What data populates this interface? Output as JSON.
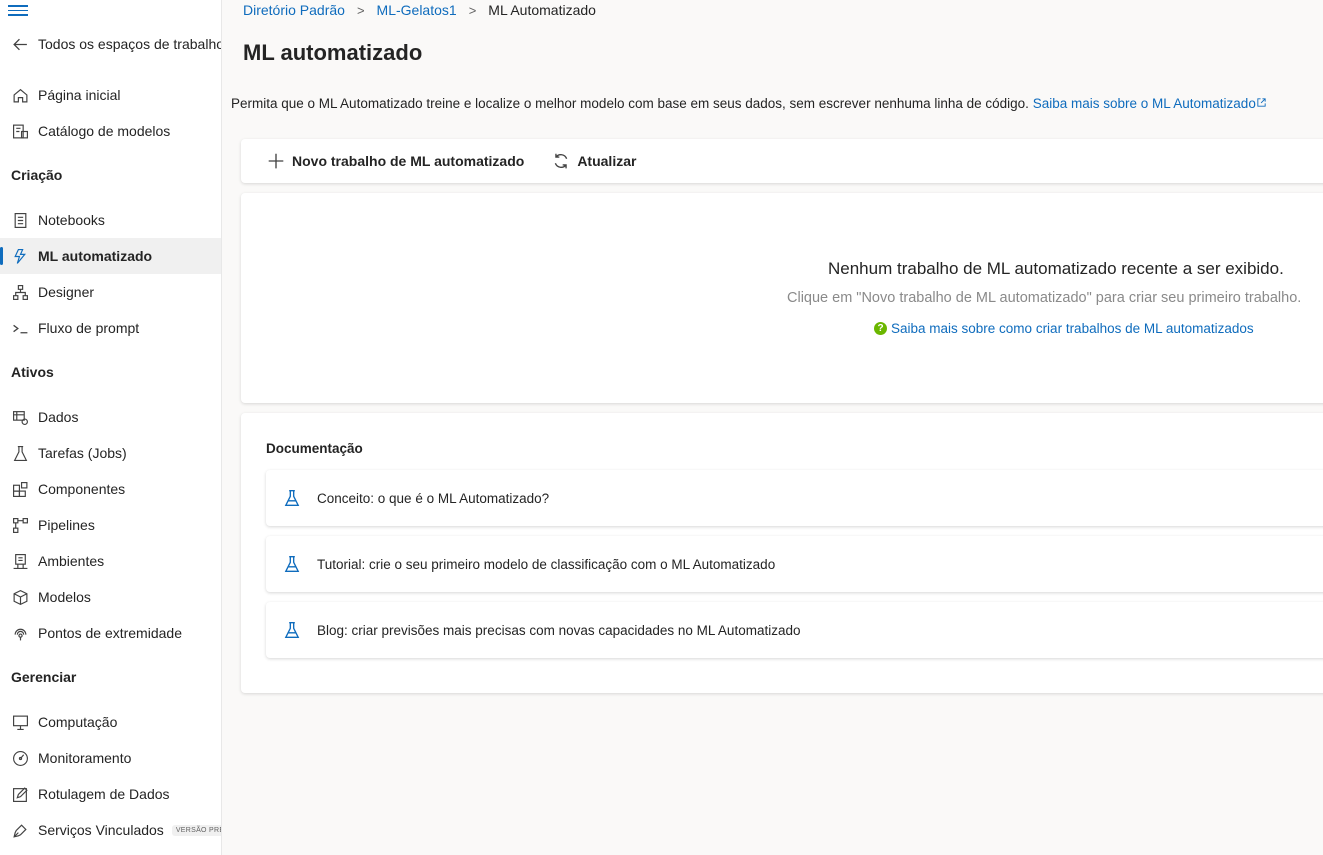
{
  "sidebar": {
    "back_label": "Todos os espaços de trabalho",
    "items_top": [
      {
        "label": "Página inicial",
        "icon": "home-icon"
      },
      {
        "label": "Catálogo de modelos",
        "icon": "model-catalog-icon"
      }
    ],
    "sections": [
      {
        "title": "Criação",
        "items": [
          {
            "label": "Notebooks",
            "icon": "notebook-icon"
          },
          {
            "label": "ML automatizado",
            "icon": "automl-icon",
            "active": true
          },
          {
            "label": "Designer",
            "icon": "designer-icon"
          },
          {
            "label": "Fluxo de prompt",
            "icon": "prompt-flow-icon"
          }
        ]
      },
      {
        "title": "Ativos",
        "items": [
          {
            "label": "Dados",
            "icon": "data-icon"
          },
          {
            "label": "Tarefas (Jobs)",
            "icon": "flask-icon"
          },
          {
            "label": "Componentes",
            "icon": "components-icon"
          },
          {
            "label": "Pipelines",
            "icon": "pipeline-icon"
          },
          {
            "label": "Ambientes",
            "icon": "environment-icon"
          },
          {
            "label": "Modelos",
            "icon": "cube-icon"
          },
          {
            "label": "Pontos de extremidade",
            "icon": "endpoint-icon"
          }
        ]
      },
      {
        "title": "Gerenciar",
        "items": [
          {
            "label": "Computação",
            "icon": "compute-icon"
          },
          {
            "label": "Monitoramento",
            "icon": "gauge-icon"
          },
          {
            "label": "Rotulagem de Dados",
            "icon": "edit-icon"
          },
          {
            "label": "Serviços Vinculados",
            "icon": "link-icon",
            "badge": "VERSÃO PRÉVIA"
          }
        ]
      }
    ]
  },
  "breadcrumb": [
    "Diretório Padrão",
    "ML-Gelatos1",
    "ML Automatizado"
  ],
  "page": {
    "title": "ML automatizado",
    "description": "Permita que o ML Automatizado treine e localize o melhor modelo com base em seus dados, sem escrever nenhuma linha de código.",
    "description_link": "Saiba mais sobre o ML Automatizado"
  },
  "toolbar": {
    "new_label": "Novo trabalho de ML automatizado",
    "refresh_label": "Atualizar"
  },
  "empty_state": {
    "title": "Nenhum trabalho de ML automatizado recente a ser exibido.",
    "subtitle": "Clique em \"Novo trabalho de ML automatizado\" para criar seu primeiro trabalho.",
    "link": "Saiba mais sobre como criar trabalhos de ML automatizados"
  },
  "documentation": {
    "title": "Documentação",
    "items": [
      "Conceito: o que é o ML Automatizado?",
      "Tutorial: crie o seu primeiro modelo de classificação com o ML Automatizado",
      "Blog: criar previsões mais precisas com novas capacidades no ML Automatizado"
    ]
  },
  "colors": {
    "accent": "#0f6cbd",
    "help": "#6bb700"
  }
}
